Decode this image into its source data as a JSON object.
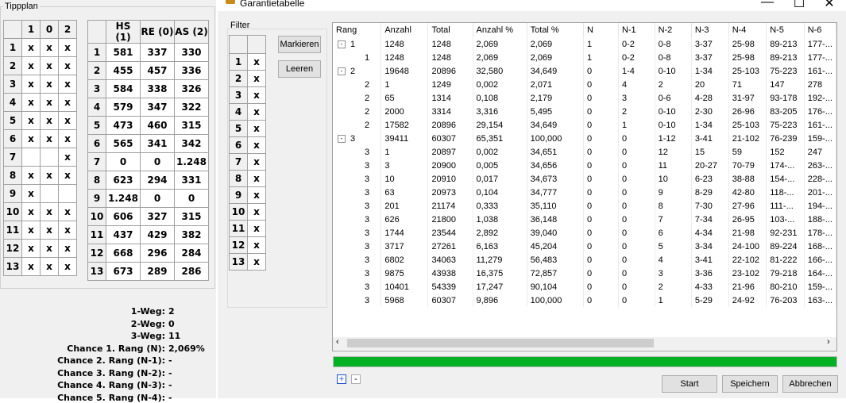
{
  "left": {
    "tippplan_title": "Tippplan",
    "tipp_headers": [
      "",
      "1",
      "0",
      "2"
    ],
    "tipp_rows": [
      [
        "1",
        "x",
        "x",
        "x"
      ],
      [
        "2",
        "x",
        "x",
        "x"
      ],
      [
        "3",
        "x",
        "x",
        "x"
      ],
      [
        "4",
        "x",
        "x",
        "x"
      ],
      [
        "5",
        "x",
        "x",
        "x"
      ],
      [
        "6",
        "x",
        "x",
        "x"
      ],
      [
        "7",
        "",
        "",
        "x"
      ],
      [
        "8",
        "x",
        "x",
        "x"
      ],
      [
        "9",
        "x",
        "",
        ""
      ],
      [
        "10",
        "x",
        "x",
        "x"
      ],
      [
        "11",
        "x",
        "x",
        "x"
      ],
      [
        "12",
        "x",
        "x",
        "x"
      ],
      [
        "13",
        "x",
        "x",
        "x"
      ]
    ],
    "score_headers": [
      "",
      "HS (1)",
      "RE (0)",
      "AS (2)"
    ],
    "score_rows": [
      [
        "1",
        "581",
        "337",
        "330"
      ],
      [
        "2",
        "455",
        "457",
        "336"
      ],
      [
        "3",
        "584",
        "338",
        "326"
      ],
      [
        "4",
        "579",
        "347",
        "322"
      ],
      [
        "5",
        "473",
        "460",
        "315"
      ],
      [
        "6",
        "565",
        "341",
        "342"
      ],
      [
        "7",
        "0",
        "0",
        "1.248"
      ],
      [
        "8",
        "623",
        "294",
        "331"
      ],
      [
        "9",
        "1.248",
        "0",
        "0"
      ],
      [
        "10",
        "606",
        "327",
        "315"
      ],
      [
        "11",
        "437",
        "429",
        "382"
      ],
      [
        "12",
        "668",
        "296",
        "284"
      ],
      [
        "13",
        "673",
        "289",
        "286"
      ]
    ],
    "stats": [
      {
        "label": "1-Weg:",
        "value": "2"
      },
      {
        "label": "2-Weg:",
        "value": "0"
      },
      {
        "label": "3-Weg:",
        "value": "11"
      },
      {
        "label": "Chance 1. Rang (N):",
        "value": "2,069%"
      },
      {
        "label": "Chance 2. Rang (N-1):",
        "value": "-"
      },
      {
        "label": "Chance 3. Rang (N-2):",
        "value": "-"
      },
      {
        "label": "Chance 4. Rang (N-3):",
        "value": "-"
      },
      {
        "label": "Chance 5. Rang (N-4):",
        "value": "-"
      }
    ]
  },
  "window": {
    "title": "Garantietabelle",
    "filter_title": "Filter",
    "filter_rows": [
      [
        "1",
        "x"
      ],
      [
        "2",
        "x"
      ],
      [
        "3",
        "x"
      ],
      [
        "4",
        "x"
      ],
      [
        "5",
        "x"
      ],
      [
        "6",
        "x"
      ],
      [
        "7",
        "x"
      ],
      [
        "8",
        "x"
      ],
      [
        "9",
        "x"
      ],
      [
        "10",
        "x"
      ],
      [
        "11",
        "x"
      ],
      [
        "12",
        "x"
      ],
      [
        "13",
        "x"
      ]
    ],
    "markieren_label": "Markieren",
    "leeren_label": "Leeren",
    "columns": [
      "Rang",
      "Anzahl",
      "Total",
      "Anzahl %",
      "Total %",
      "N",
      "N-1",
      "N-2",
      "N-3",
      "N-4",
      "N-5",
      "N-6"
    ],
    "rows": [
      {
        "level": 0,
        "expander": "-",
        "cells": [
          "1",
          "1248",
          "1248",
          "2,069",
          "2,069",
          "1",
          "0-2",
          "0-8",
          "3-37",
          "25-98",
          "89-213",
          "177-..."
        ]
      },
      {
        "level": 1,
        "cells": [
          "1",
          "1248",
          "1248",
          "2,069",
          "2,069",
          "1",
          "0-2",
          "0-8",
          "3-37",
          "25-98",
          "89-213",
          "177-..."
        ]
      },
      {
        "level": 0,
        "expander": "-",
        "cells": [
          "2",
          "19648",
          "20896",
          "32,580",
          "34,649",
          "0",
          "1-4",
          "0-10",
          "1-34",
          "25-103",
          "75-223",
          "161-..."
        ]
      },
      {
        "level": 1,
        "cells": [
          "2",
          "1",
          "1249",
          "0,002",
          "2,071",
          "0",
          "4",
          "2",
          "20",
          "71",
          "147",
          "278"
        ]
      },
      {
        "level": 1,
        "cells": [
          "2",
          "65",
          "1314",
          "0,108",
          "2,179",
          "0",
          "3",
          "0-6",
          "4-28",
          "31-97",
          "93-178",
          "192-..."
        ]
      },
      {
        "level": 1,
        "cells": [
          "2",
          "2000",
          "3314",
          "3,316",
          "5,495",
          "0",
          "2",
          "0-10",
          "2-30",
          "26-96",
          "83-205",
          "176-..."
        ]
      },
      {
        "level": 1,
        "cells": [
          "2",
          "17582",
          "20896",
          "29,154",
          "34,649",
          "0",
          "1",
          "0-10",
          "1-34",
          "25-103",
          "75-223",
          "161-..."
        ]
      },
      {
        "level": 0,
        "expander": "-",
        "cells": [
          "3",
          "39411",
          "60307",
          "65,351",
          "100,000",
          "0",
          "0",
          "1-12",
          "3-41",
          "21-102",
          "76-239",
          "159-..."
        ]
      },
      {
        "level": 1,
        "cells": [
          "3",
          "1",
          "20897",
          "0,002",
          "34,651",
          "0",
          "0",
          "12",
          "15",
          "59",
          "152",
          "247"
        ]
      },
      {
        "level": 1,
        "cells": [
          "3",
          "3",
          "20900",
          "0,005",
          "34,656",
          "0",
          "0",
          "11",
          "20-27",
          "70-79",
          "174-...",
          "263-..."
        ]
      },
      {
        "level": 1,
        "cells": [
          "3",
          "10",
          "20910",
          "0,017",
          "34,673",
          "0",
          "0",
          "10",
          "6-23",
          "38-88",
          "154-...",
          "228-..."
        ]
      },
      {
        "level": 1,
        "cells": [
          "3",
          "63",
          "20973",
          "0,104",
          "34,777",
          "0",
          "0",
          "9",
          "8-29",
          "42-80",
          "118-...",
          "201-..."
        ]
      },
      {
        "level": 1,
        "cells": [
          "3",
          "201",
          "21174",
          "0,333",
          "35,110",
          "0",
          "0",
          "8",
          "7-30",
          "27-96",
          "111-...",
          "194-..."
        ]
      },
      {
        "level": 1,
        "cells": [
          "3",
          "626",
          "21800",
          "1,038",
          "36,148",
          "0",
          "0",
          "7",
          "7-34",
          "26-95",
          "103-...",
          "188-..."
        ]
      },
      {
        "level": 1,
        "cells": [
          "3",
          "1744",
          "23544",
          "2,892",
          "39,040",
          "0",
          "0",
          "6",
          "4-34",
          "21-98",
          "92-231",
          "178-..."
        ]
      },
      {
        "level": 1,
        "cells": [
          "3",
          "3717",
          "27261",
          "6,163",
          "45,204",
          "0",
          "0",
          "5",
          "3-34",
          "24-100",
          "89-224",
          "168-..."
        ]
      },
      {
        "level": 1,
        "cells": [
          "3",
          "6802",
          "34063",
          "11,279",
          "56,483",
          "0",
          "0",
          "4",
          "3-41",
          "22-102",
          "81-222",
          "166-..."
        ]
      },
      {
        "level": 1,
        "cells": [
          "3",
          "9875",
          "43938",
          "16,375",
          "72,857",
          "0",
          "0",
          "3",
          "3-36",
          "23-102",
          "79-218",
          "164-..."
        ]
      },
      {
        "level": 1,
        "cells": [
          "3",
          "10401",
          "54339",
          "17,247",
          "90,104",
          "0",
          "0",
          "2",
          "4-33",
          "21-96",
          "80-210",
          "159-..."
        ]
      },
      {
        "level": 1,
        "cells": [
          "3",
          "5968",
          "60307",
          "9,896",
          "100,000",
          "0",
          "0",
          "1",
          "5-29",
          "24-92",
          "76-203",
          "163-..."
        ]
      }
    ],
    "progress_fraction": 1.0,
    "colors": {
      "progress": "#06b025"
    },
    "expand_all_label": "+",
    "collapse_all_label": "-",
    "start_label": "Start",
    "save_label": "Speichern",
    "cancel_label": "Abbrechen"
  }
}
